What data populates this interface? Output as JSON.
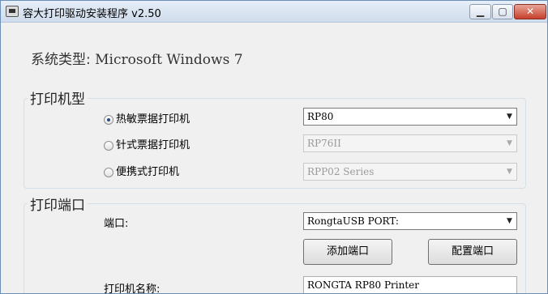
{
  "window": {
    "title": "容大打印驱动安装程序 v2.50",
    "controls": {
      "minimize_icon": "minimize-icon",
      "maximize_icon": "maximize-icon",
      "close_icon": "close-icon"
    }
  },
  "system_type": {
    "label": "系统类型:",
    "value": "Microsoft Windows 7"
  },
  "printer_type_group": {
    "title": "打印机型",
    "options": [
      {
        "label": "热敏票据打印机",
        "selected": true,
        "model": "RP80",
        "enabled": true
      },
      {
        "label": "针式票据打印机",
        "selected": false,
        "model": "RP76II",
        "enabled": false
      },
      {
        "label": "便携式打印机",
        "selected": false,
        "model": "RPP02 Series",
        "enabled": false
      }
    ]
  },
  "port_group": {
    "title": "打印端口",
    "port_label": "端口:",
    "port_value": "RongtaUSB PORT:",
    "add_port_button": "添加端口",
    "config_port_button": "配置端口",
    "printer_name_label": "打印机名称:",
    "printer_name_value": "RONGTA RP80 Printer"
  }
}
